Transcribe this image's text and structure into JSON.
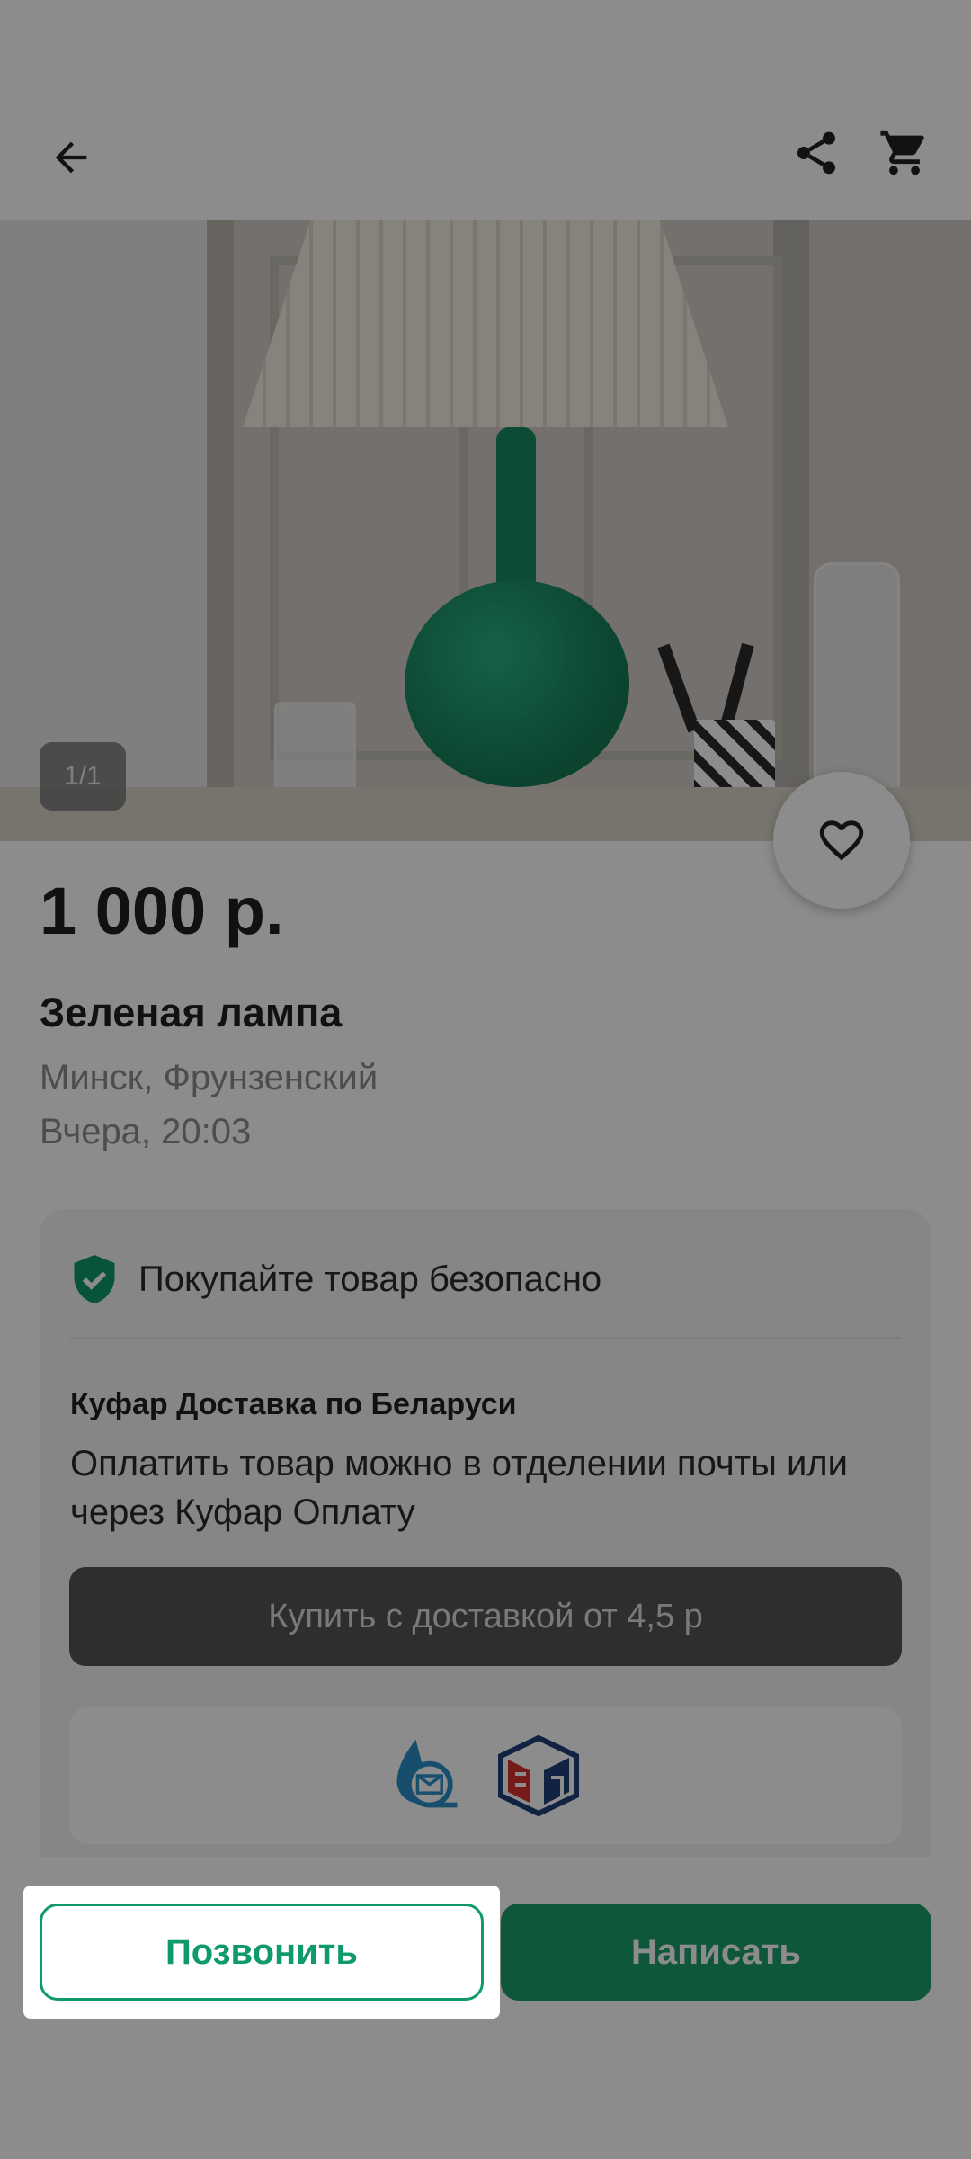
{
  "colors": {
    "accent": "#1a9e6c",
    "shield": "#0f9a6b",
    "buy_button": "#555555",
    "price_text": "#1f1f1f",
    "meta_text": "#8c8c8c"
  },
  "header": {
    "back_icon": "arrow-left-icon",
    "share_icon": "share-icon",
    "cart_icon": "cart-icon"
  },
  "gallery": {
    "counter": "1/1",
    "favorite_icon": "heart-icon"
  },
  "listing": {
    "price": "1 000 р.",
    "title": "Зеленая лампа",
    "location": "Минск, Фрунзенский",
    "date": "Вчера, 20:03"
  },
  "safe_purchase": {
    "icon": "shield-check-icon",
    "text": "Покупайте товар безопасно"
  },
  "delivery": {
    "title": "Куфар Доставка по Беларуси",
    "description": "Оплатить товар можно в отделении почты или через Куфар Оплату",
    "buy_button": "Купить с доставкой от 4,5 р",
    "logos": [
      "belpost-logo",
      "evropochta-logo"
    ]
  },
  "actions": {
    "call_label": "Позвонить",
    "write_label": "Написать"
  }
}
